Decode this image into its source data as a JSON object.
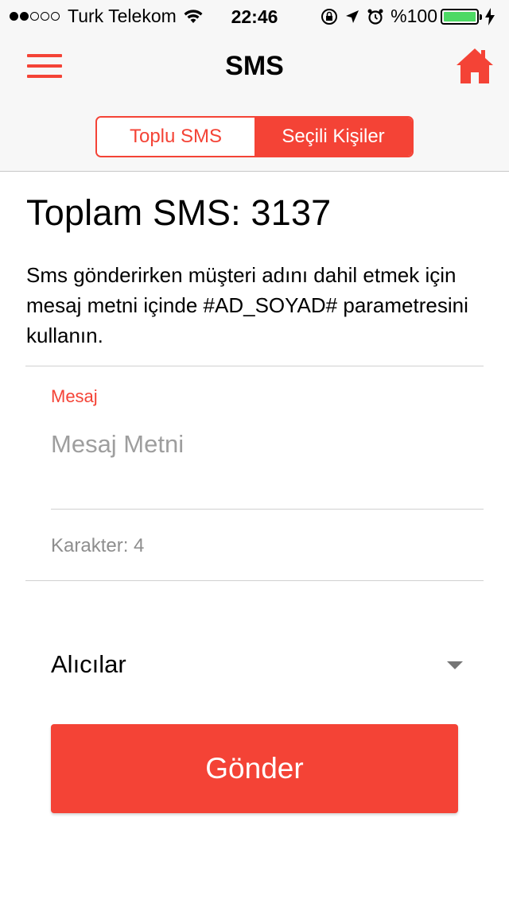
{
  "status_bar": {
    "carrier": "Turk Telekom",
    "time": "22:46",
    "battery": "%100",
    "signal_dots_filled": 2,
    "signal_dots_total": 5,
    "battery_level": 1.0
  },
  "nav": {
    "title": "SMS",
    "menu_icon": "hamburger-menu-icon",
    "home_icon": "home-icon"
  },
  "segment": {
    "options": [
      "Toplu SMS",
      "Seçili Kişiler"
    ],
    "selected": "Seçili Kişiler"
  },
  "content": {
    "total_sms": "Toplam SMS: 3137",
    "info_text": "Sms gönderirken müşteri adını dahil etmek için mesaj metni içinde #AD_SOYAD# parametresini kullanın.",
    "message_label": "Mesaj",
    "message_placeholder": "Mesaj Metni",
    "message_value": "",
    "char_count": "Karakter: 4",
    "recipients_label": "Alıcılar",
    "send_label": "Gönder"
  },
  "colors": {
    "accent": "#f44336",
    "battery": "#4cd964",
    "background": "#ffffff",
    "navbar": "#f7f7f7"
  }
}
